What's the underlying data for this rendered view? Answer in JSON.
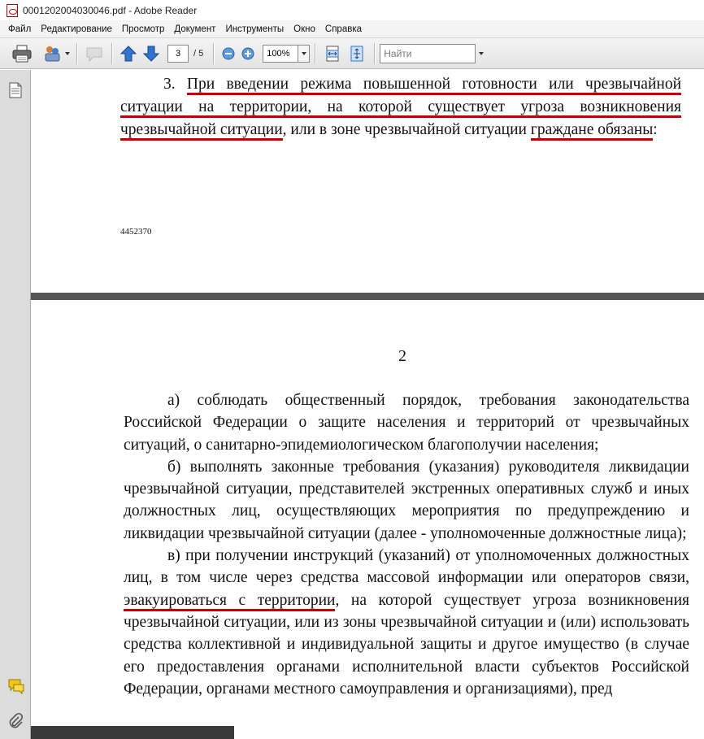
{
  "window": {
    "title": "0001202004030046.pdf - Adobe Reader"
  },
  "menu": [
    "Файл",
    "Редактирование",
    "Просмотр",
    "Документ",
    "Инструменты",
    "Окно",
    "Справка"
  ],
  "toolbar": {
    "page_current": "3",
    "page_total": "/ 5",
    "zoom": "100%",
    "find_placeholder": "Найти",
    "icons": [
      "print-icon",
      "share-icon",
      "comment-icon",
      "previous-page-icon",
      "next-page-icon",
      "zoom-out-icon",
      "zoom-in-icon",
      "fit-width-icon",
      "fit-page-icon"
    ]
  },
  "navpanel": {
    "icons": [
      "page-thumbnails-icon",
      "comments-icon",
      "attachments-icon"
    ]
  },
  "document": {
    "page1": {
      "lead": "3.",
      "underlined_1": "При введении режима повышенной готовности или чрезвычайной ситуации на территории, на которой существует угроза возникновения чрезвычайной ситуации",
      "middle": ", или в зоне чрезвычайной ситуации",
      "underlined_2": "граждане обязаны",
      "tail": ":",
      "code": "4452370"
    },
    "page2": {
      "page_number": "2",
      "para_a": "а) соблюдать общественный порядок, требования законодательства Российской Федерации о защите населения и территорий от чрезвычайных ситуаций, о санитарно-эпидемиологическом благополучии населения;",
      "para_b": "б) выполнять законные требования (указания) руководителя ликвидации чрезвычайной ситуации, представителей экстренных оперативных служб и иных должностных лиц, осуществляющих мероприятия по предупреждению и ликвидации чрезвычайной ситуации (далее - уполномоченные должностные лица);",
      "para_c_before": "в) при получении инструкций (указаний) от уполномоченных должностных лиц, в том числе через средства массовой информации или операторов связи,",
      "para_c_underlined": "эвакуироваться с территории",
      "para_c_after": ", на которой существует угроза возникновения чрезвычайной ситуации, или из зоны чрезвычайной ситуации и (или) использовать средства коллективной и индивидуальной защиты и другое имущество (в случае его предоставления органами исполнительной власти субъектов Российской Федерации, органами местного самоуправления и организациями), пред"
    },
    "underline_color": "#c80000"
  }
}
